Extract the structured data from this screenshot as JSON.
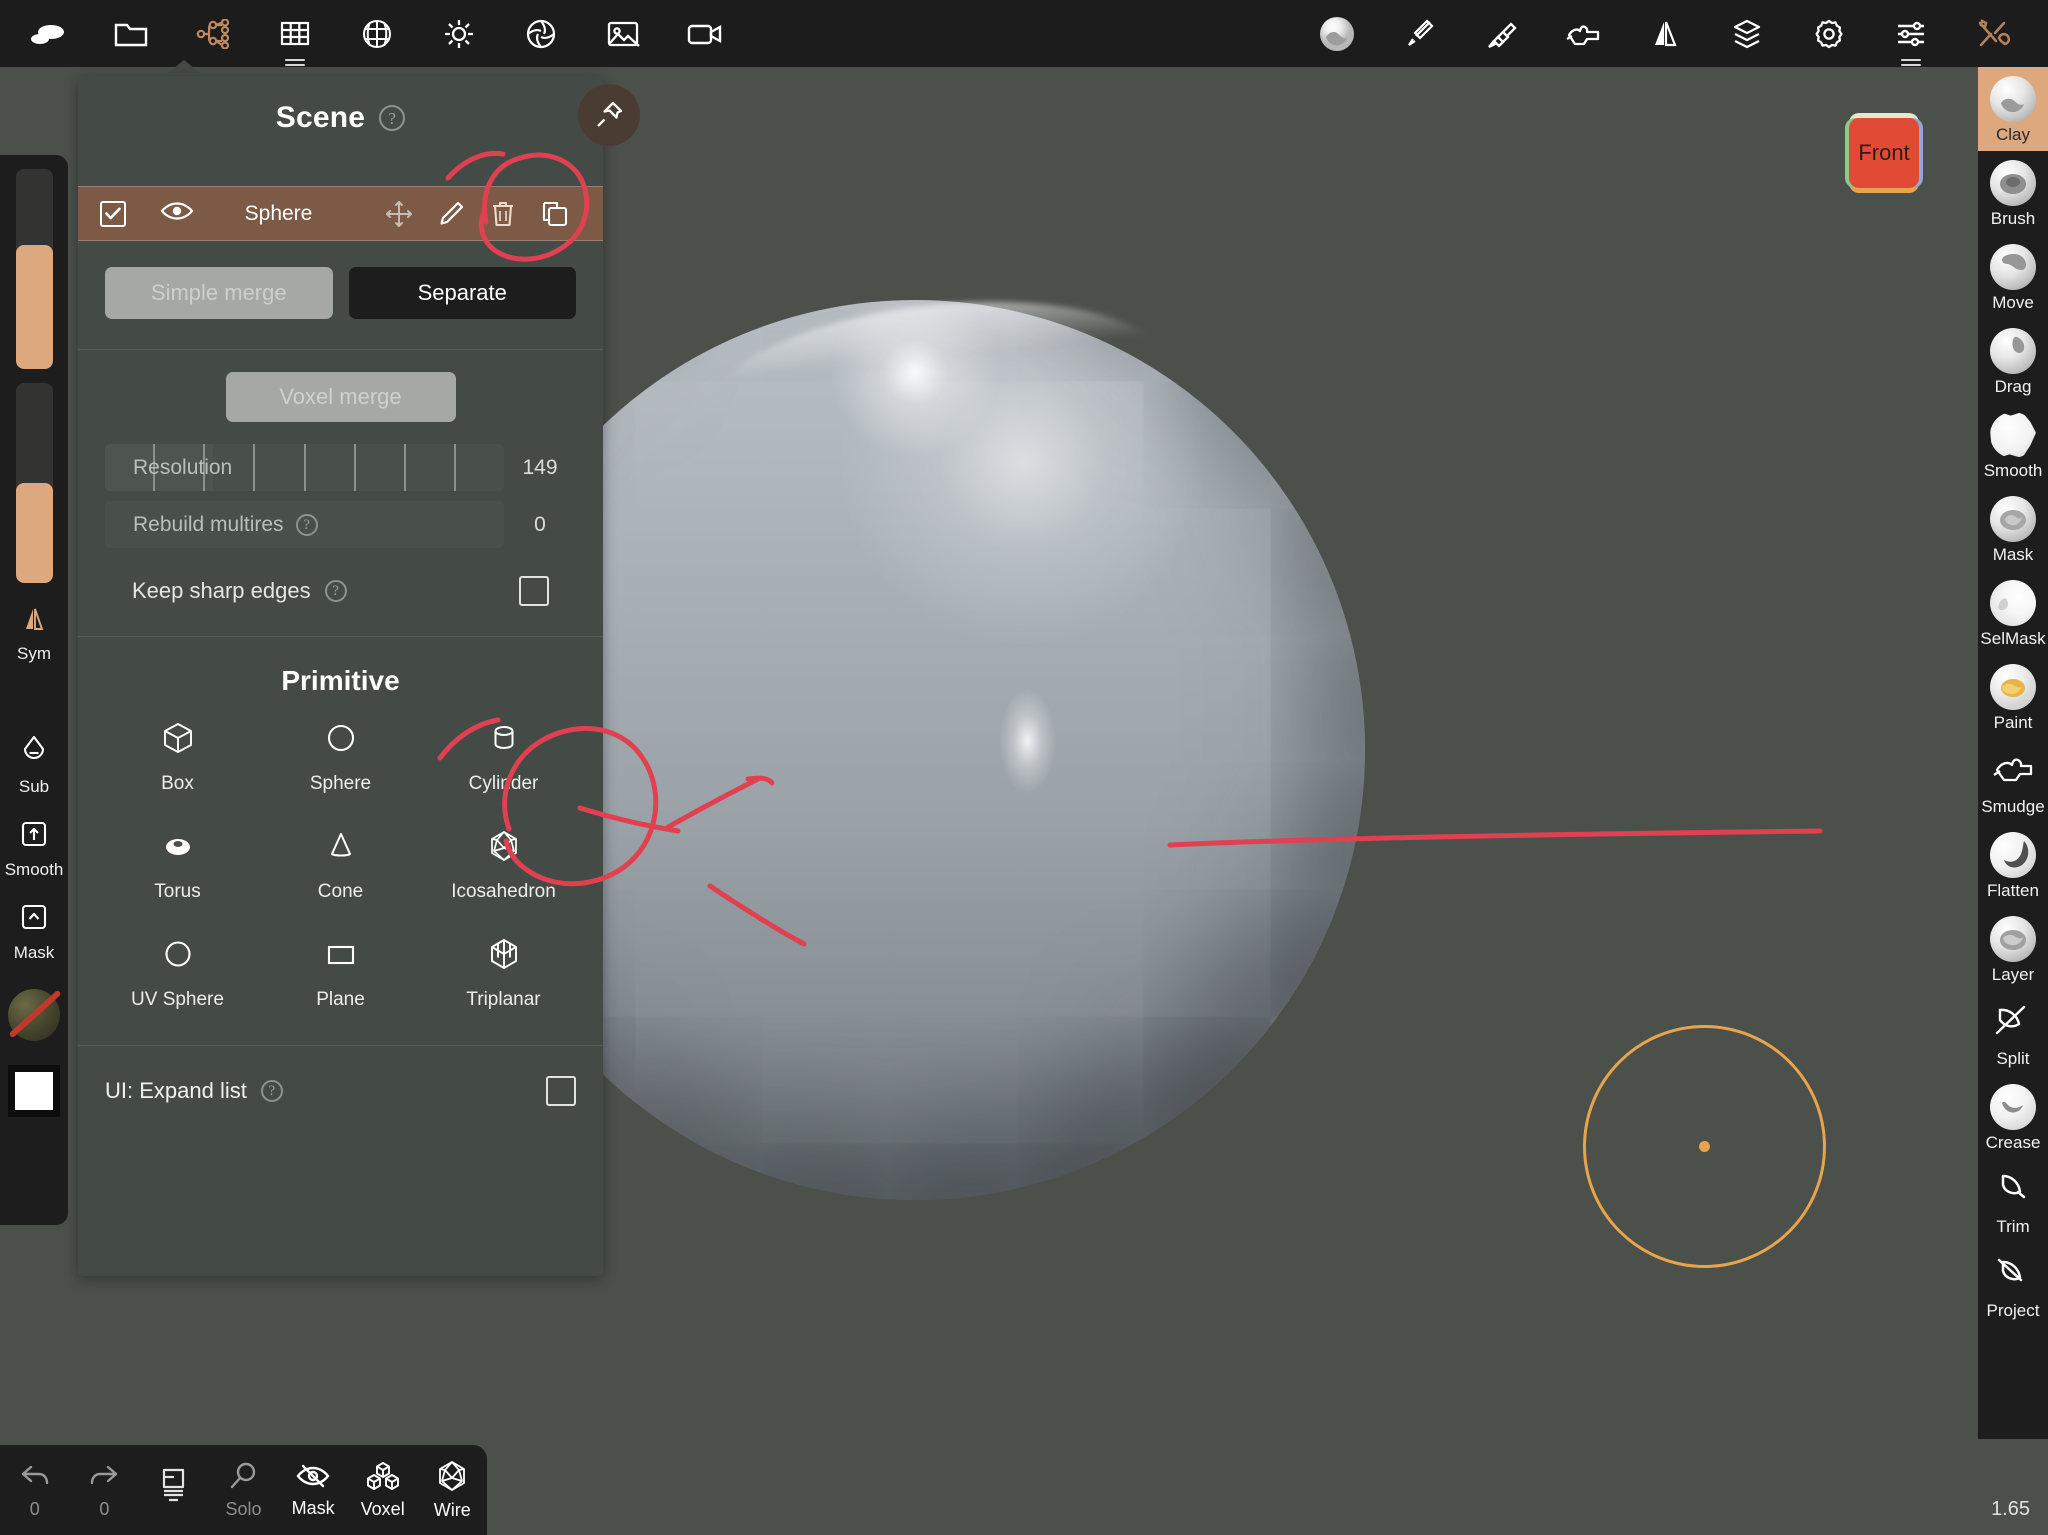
{
  "app": {
    "zoom_level": "1.65",
    "background_color": "#4b504b",
    "accent_color": "#dda87e",
    "annotation_color": "#e0404f",
    "brush_cursor_color": "#e8a44c"
  },
  "topbar": {
    "left_tools": [
      {
        "name": "sculpt-stroke-icon",
        "label": "Stroke"
      },
      {
        "name": "folder-icon",
        "label": "Files"
      },
      {
        "name": "scene-graph-icon",
        "label": "Scene",
        "active": true
      },
      {
        "name": "grid-icon",
        "label": "Grid"
      },
      {
        "name": "sphere-grid-icon",
        "label": "Topology"
      },
      {
        "name": "sun-icon",
        "label": "Light"
      },
      {
        "name": "aperture-icon",
        "label": "Camera"
      },
      {
        "name": "image-icon",
        "label": "Background"
      },
      {
        "name": "video-icon",
        "label": "Render"
      }
    ],
    "right_tools": [
      {
        "name": "material-ball-icon",
        "label": "Material"
      },
      {
        "name": "brush-icon",
        "label": "Brush"
      },
      {
        "name": "stamp-icon",
        "label": "Alpha"
      },
      {
        "name": "stroke-hand-icon",
        "label": "Stroke"
      },
      {
        "name": "mirror-icon",
        "label": "Symmetry"
      },
      {
        "name": "layers-icon",
        "label": "Layers"
      },
      {
        "name": "gear-icon",
        "label": "Settings"
      },
      {
        "name": "sliders-icon",
        "label": "Preferences"
      },
      {
        "name": "tools-icon",
        "label": "Tools"
      }
    ]
  },
  "scene_panel": {
    "title": "Scene",
    "help_glyph": "?",
    "pin_tooltip": "Pin panel",
    "object_row": {
      "checked": true,
      "visible": true,
      "name": "Sphere",
      "actions": [
        "move-icon",
        "edit-icon",
        "delete-icon",
        "duplicate-icon"
      ]
    },
    "merge": {
      "simple_merge_label": "Simple merge",
      "separate_label": "Separate"
    },
    "voxel": {
      "voxel_merge_label": "Voxel merge",
      "resolution_label": "Resolution",
      "resolution_value": "149",
      "rebuild_multires_label": "Rebuild multires",
      "rebuild_multires_value": "0",
      "keep_sharp_edges_label": "Keep sharp edges",
      "keep_sharp_edges_checked": false
    },
    "primitive": {
      "title": "Primitive",
      "items": [
        {
          "label": "Box",
          "icon": "box-icon"
        },
        {
          "label": "Sphere",
          "icon": "circle-icon"
        },
        {
          "label": "Cylinder",
          "icon": "cylinder-icon"
        },
        {
          "label": "Torus",
          "icon": "torus-icon"
        },
        {
          "label": "Cone",
          "icon": "cone-icon"
        },
        {
          "label": "Icosahedron",
          "icon": "icosahedron-icon"
        },
        {
          "label": "UV Sphere",
          "icon": "uv-sphere-icon"
        },
        {
          "label": "Plane",
          "icon": "plane-icon"
        },
        {
          "label": "Triplanar",
          "icon": "triplanar-icon"
        }
      ]
    },
    "expand": {
      "label": "UI: Expand list",
      "checked": false
    }
  },
  "left_sidebar": {
    "radius_slider": {
      "name": "radius-slider",
      "fill_percent": 62
    },
    "intensity_slider": {
      "name": "intensity-slider",
      "fill_percent": 50
    },
    "items": [
      {
        "label": "Sym",
        "icon": "mirror-icon"
      },
      {
        "label": "Sub",
        "icon": "drop-minus-icon"
      },
      {
        "label": "Smooth",
        "icon": "square-up-arrow-icon"
      },
      {
        "label": "Mask",
        "icon": "square-chevron-up-icon"
      }
    ],
    "material_preview": {
      "name": "material-preview-disabled",
      "disabled": true
    },
    "color_swatch": {
      "name": "color-swatch",
      "color": "#ffffff"
    }
  },
  "right_sidebar": {
    "tools": [
      {
        "label": "Clay",
        "active": true
      },
      {
        "label": "Brush",
        "active": false
      },
      {
        "label": "Move",
        "active": false
      },
      {
        "label": "Drag",
        "active": false
      },
      {
        "label": "Smooth",
        "active": false
      },
      {
        "label": "Mask",
        "active": false
      },
      {
        "label": "SelMask",
        "active": false
      },
      {
        "label": "Paint",
        "active": false
      },
      {
        "label": "Smudge",
        "active": false
      },
      {
        "label": "Flatten",
        "active": false
      },
      {
        "label": "Layer",
        "active": false
      },
      {
        "label": "Split",
        "active": false
      },
      {
        "label": "Crease",
        "active": false
      },
      {
        "label": "Trim",
        "active": false
      },
      {
        "label": "Project",
        "active": false
      }
    ]
  },
  "bottom_bar": {
    "items": [
      {
        "label": "0",
        "icon": "undo-icon",
        "dim": true
      },
      {
        "label": "0",
        "icon": "redo-icon",
        "dim": true
      },
      {
        "label": "",
        "icon": "layers-list-icon",
        "dim": true
      },
      {
        "label": "Solo",
        "icon": "magnifier-icon",
        "dim": true
      },
      {
        "label": "Mask",
        "icon": "eye-off-icon",
        "dim": false
      },
      {
        "label": "Voxel",
        "icon": "voxel-cubes-icon",
        "dim": false
      },
      {
        "label": "Wire",
        "icon": "wireframe-icon",
        "dim": false
      }
    ]
  },
  "viewport": {
    "view_gizmo_label": "Front",
    "object": "Sphere"
  },
  "annotations": [
    {
      "name": "annotation-circle-delete",
      "target": "delete-icon",
      "shape": "ellipse"
    },
    {
      "name": "annotation-circle-cylinder",
      "target": "Cylinder",
      "shape": "ellipse"
    },
    {
      "name": "annotation-arrow-to-cylinder",
      "target": "Cylinder",
      "shape": "arrow"
    }
  ]
}
